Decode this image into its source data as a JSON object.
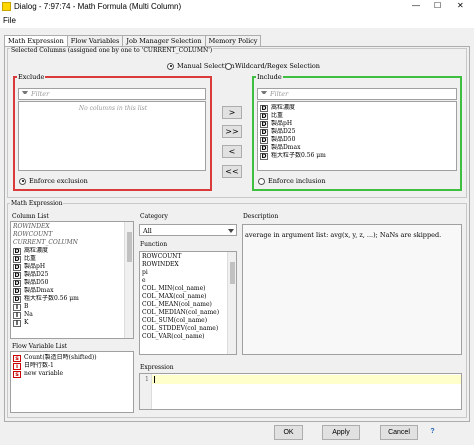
{
  "window": {
    "title": "Dialog - 7:97:74 - Math Formula (Multi Column)",
    "minimize": "—",
    "maximize": "☐",
    "close": "✕"
  },
  "menu": {
    "file": "File"
  },
  "tabs": [
    "Math Expression",
    "Flow Variables",
    "Job Manager Selection",
    "Memory Policy"
  ],
  "selected_columns": {
    "title": "Selected Columns (assigned one by one to 'CURRENT_COLUMN')",
    "manual_label": "Manual Selection",
    "wildcard_label": "Wildcard/Regex Selection",
    "exclude": {
      "title": "Exclude",
      "placeholder": "Filter",
      "empty": "No columns in this list",
      "enforce": "Enforce exclusion"
    },
    "include": {
      "title": "Include",
      "placeholder": "Filter",
      "enforce": "Enforce inclusion",
      "items": [
        {
          "type": "D",
          "name": "嵩粒濃度"
        },
        {
          "type": "D",
          "name": "比重"
        },
        {
          "type": "D",
          "name": "製品pH"
        },
        {
          "type": "D",
          "name": "製品D25"
        },
        {
          "type": "D",
          "name": "製品D50"
        },
        {
          "type": "D",
          "name": "製品Dmax"
        },
        {
          "type": "D",
          "name": "粗大粒子数0.56 μm"
        }
      ]
    },
    "buttons": [
      ">",
      ">>",
      "<",
      "<<"
    ]
  },
  "math_expression": {
    "title": "Math Expression",
    "column_list": {
      "title": "Column List",
      "special": [
        "ROWINDEX",
        "ROWCOUNT",
        "CURRENT_COLUMN"
      ],
      "items": [
        {
          "type": "D",
          "name": "嵩粒濃度"
        },
        {
          "type": "D",
          "name": "比重"
        },
        {
          "type": "D",
          "name": "製品pH"
        },
        {
          "type": "D",
          "name": "製品D25"
        },
        {
          "type": "D",
          "name": "製品D50"
        },
        {
          "type": "D",
          "name": "製品Dmax"
        },
        {
          "type": "D",
          "name": "粗大粒子数0.56 μm"
        },
        {
          "type": "I",
          "name": "B"
        },
        {
          "type": "I",
          "name": "Na"
        },
        {
          "type": "I",
          "name": "K"
        }
      ]
    },
    "category": {
      "title": "Category",
      "selected": "All"
    },
    "function": {
      "title": "Function",
      "items": [
        "ROWCOUNT",
        "ROWINDEX",
        "pi",
        "e",
        "COL_MIN(col_name)",
        "COL_MAX(col_name)",
        "COL_MEAN(col_name)",
        "COL_MEDIAN(col_name)",
        "COL_SUM(col_name)",
        "COL_STDDEV(col_name)",
        "COL_VAR(col_name)"
      ]
    },
    "description": {
      "title": "Description",
      "text": "average in argument list: avg(x, y, z, ...); NaNs are skipped."
    },
    "flow_variable_list": {
      "title": "Flow Variable List",
      "items": [
        {
          "type": "s",
          "name": "Count(製造日時(shifted))"
        },
        {
          "type": "i",
          "name": "日時行数-1"
        },
        {
          "type": "s",
          "name": "new variable"
        }
      ]
    },
    "expression": {
      "title": "Expression",
      "line": "1"
    }
  },
  "footer": {
    "ok": "OK",
    "apply": "Apply",
    "cancel": "Cancel",
    "help": "?"
  },
  "colors": {
    "exclude_border": "#d93a3a",
    "include_border": "#3fbf3f",
    "expression_highlight": "#ffffcc"
  }
}
